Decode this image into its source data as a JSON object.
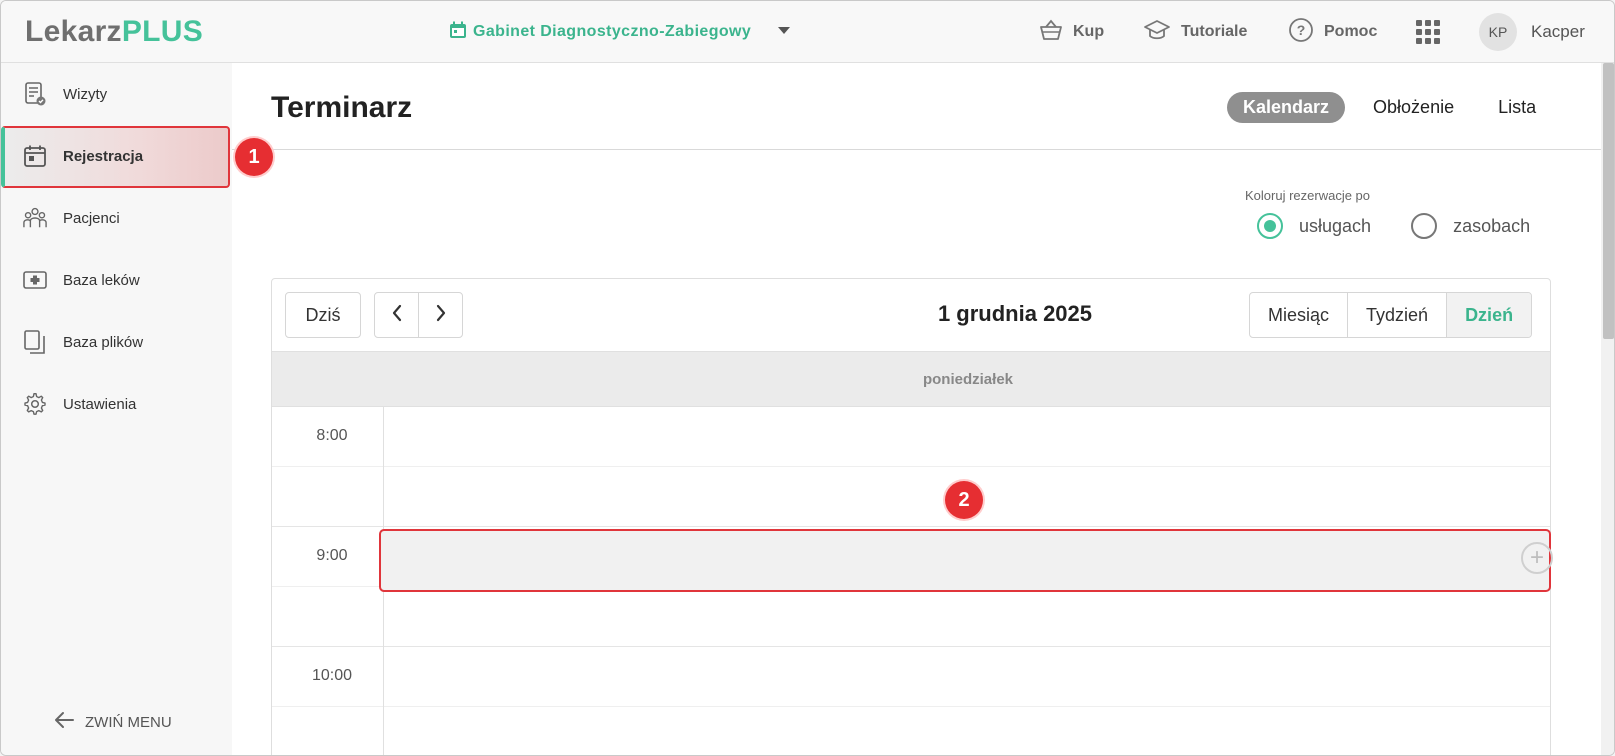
{
  "header": {
    "logo_part1": "Lekarz",
    "logo_part2": "PLUS",
    "clinic_name": "Gabinet Diagnostyczno-Zabiegowy",
    "actions": {
      "buy": "Kup",
      "tutorials": "Tutoriale",
      "help": "Pomoc"
    },
    "user_initials": "KP",
    "user_name": "Kacper"
  },
  "sidebar": {
    "items": [
      {
        "label": "Wizyty",
        "icon": "document-check-icon"
      },
      {
        "label": "Rejestracja",
        "icon": "calendar-icon"
      },
      {
        "label": "Pacjenci",
        "icon": "people-icon"
      },
      {
        "label": "Baza leków",
        "icon": "medkit-icon"
      },
      {
        "label": "Baza plików",
        "icon": "files-icon"
      },
      {
        "label": "Ustawienia",
        "icon": "gear-icon"
      }
    ],
    "collapse_label": "ZWIŃ MENU"
  },
  "main": {
    "title": "Terminarz",
    "view_tabs": [
      "Kalendarz",
      "Obłożenie",
      "Lista"
    ],
    "active_view_tab": "Kalendarz",
    "color_by_label": "Koloruj rezerwacje po",
    "color_by_options": [
      "usługach",
      "zasobach"
    ],
    "color_by_selected": "usługach"
  },
  "calendar": {
    "today_label": "Dziś",
    "current_date": "1 grudnia 2025",
    "range_options": [
      "Miesiąc",
      "Tydzień",
      "Dzień"
    ],
    "active_range": "Dzień",
    "day_name": "poniedziałek",
    "time_labels": [
      "8:00",
      "9:00",
      "10:00"
    ]
  },
  "annotations": {
    "step1": "1",
    "step2": "2"
  },
  "colors": {
    "accent_green": "#45c29a",
    "annotation_red": "#e62e32",
    "active_tab_gray": "#8f8f8f"
  }
}
